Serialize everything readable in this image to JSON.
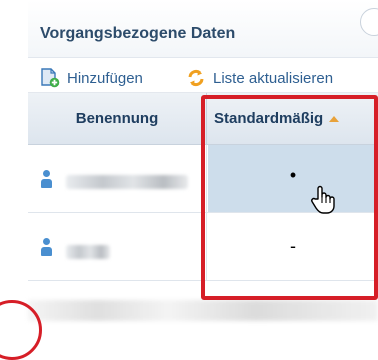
{
  "panel": {
    "title": "Vorgangsbezogene Daten"
  },
  "toolbar": {
    "add_label": "Hinzufügen",
    "refresh_label": "Liste aktualisieren",
    "add_icon": "add-document-icon",
    "refresh_icon": "refresh-icon"
  },
  "grid": {
    "columns": [
      "Benennung",
      "Standardmäßig"
    ],
    "sorted_column": "Standardmäßig",
    "sort_direction": "ascending",
    "rows": [
      {
        "icon": "person-icon",
        "name": "",
        "default": "•",
        "selected": true
      },
      {
        "icon": "person-icon",
        "name": "",
        "default": "-",
        "selected": false
      }
    ]
  },
  "colors": {
    "header_text": "#2d4c6b",
    "link_text": "#2e5f91",
    "selected_cell": "#cdddeb",
    "highlight_border": "#d61e27",
    "sort_arrow": "#e8a23a"
  }
}
